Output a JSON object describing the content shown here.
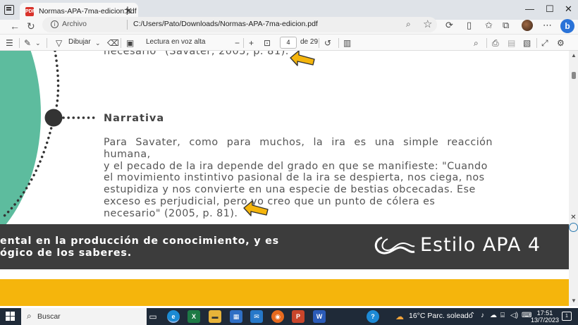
{
  "browser": {
    "tab_title": "Normas-APA-7ma-edicion.pdf",
    "address_label": "Archivo",
    "url": "C:/Users/Pato/Downloads/Normas-APA-7ma-edicion.pdf"
  },
  "pdf_toolbar": {
    "draw_label": "Dibujar",
    "read_aloud_label": "Lectura en voz alta",
    "current_page": "4",
    "page_count_label": "de 29"
  },
  "document": {
    "top_quote": "necesario\" (Savater, 2005, p. 81).",
    "heading": "Narrativa",
    "paragraph_lines": [
      "Para Savater, como para muchos, la ira es una simple reacción humana,",
      "y el pecado de la ira depende del grado en que se manifieste: \"Cuando",
      "el movimiento instintivo pasional de la ira se despierta, nos ciega, nos",
      "estupidiza y nos convierte en una especie de bestias obcecadas. Ese",
      "exceso es perjudicial, pero yo creo que un punto de cólera es",
      "necesario\" (2005, p. 81)."
    ],
    "band_lines": [
      "ental en la producción de conocimiento, y es",
      "ógico de los saberes."
    ],
    "brand": "Estilo APA 4",
    "colors": {
      "teal": "#5dbc9e",
      "band": "#3c3c3c",
      "yellow": "#f5b50c",
      "arrow": "#f5b50c"
    }
  },
  "taskbar": {
    "search_label": "Buscar",
    "weather": "16°C  Parc. soleado",
    "time": "17:51",
    "date": "13/7/2023"
  }
}
